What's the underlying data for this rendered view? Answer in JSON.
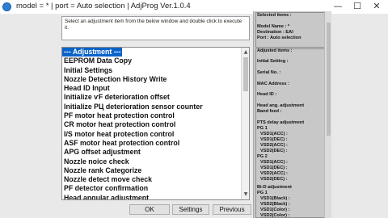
{
  "window": {
    "title": "model = * | port = Auto selection | AdjProg Ver.1.0.4",
    "min_symbol": "—",
    "max_symbol": "☐",
    "close_symbol": "✕"
  },
  "instruction": "Select an adjustment item from the below window and double click to execute it.",
  "list": {
    "items": [
      "--- Adjustment ---",
      "EEPROM Data Copy",
      "Initial Settings",
      "Nozzle Detection History Write",
      "Head ID Input",
      "Initialize ѵF deterioration offset",
      "Initialize PЦ deterioration sensor counter",
      "PF motor heat protection control",
      "CR motor heat protection control",
      "I/S motor heat protection control",
      "ASF motor heat protection control",
      "APG offset adjustment",
      "Nozzle noice check",
      "Nozzle rank Categorize",
      "Nozzle detect move check",
      "PF detector confirmation",
      "Head angular adjustment"
    ],
    "scroll_up": "▲",
    "scroll_down": "▼"
  },
  "buttons": {
    "ok": "OK",
    "settings": "Settings",
    "previous": "Previous"
  },
  "side": {
    "selected_items": "Selected items :",
    "model_name": "Model Name : *",
    "destination": "Destination : EAI",
    "port": "Port : Auto selection",
    "adjusted_items": "Adjusted items :",
    "initial_setting": "Initial Setting :",
    "serial_no": "Serial No. :",
    "mac_address": "MAC Address :",
    "head_id": "Head ID :",
    "head_ang_1": "Head ang. adjustment",
    "head_ang_2": "Band feed :",
    "pts_delay": "PTS delay adjustment",
    "pg1": "PG 1",
    "pg1_rows": [
      "VSD1(ACC) :",
      "VSD1(DEC) :",
      "VSD2(ACC) :",
      "VSD2(DEC) :"
    ],
    "pg2": "PG 2",
    "pg2_rows": [
      "VSD1(ACC) :",
      "VSD1(DEC) :",
      "VSD2(ACC) :",
      "VSD2(DEC) :"
    ],
    "bid": "Bi-D adjustment",
    "pg1b": "PG 1",
    "bid_rows": [
      "VSD1(Black) :",
      "VSD2(Black) :",
      "VSD1(Color) :",
      "VSD2(Color) :"
    ]
  }
}
